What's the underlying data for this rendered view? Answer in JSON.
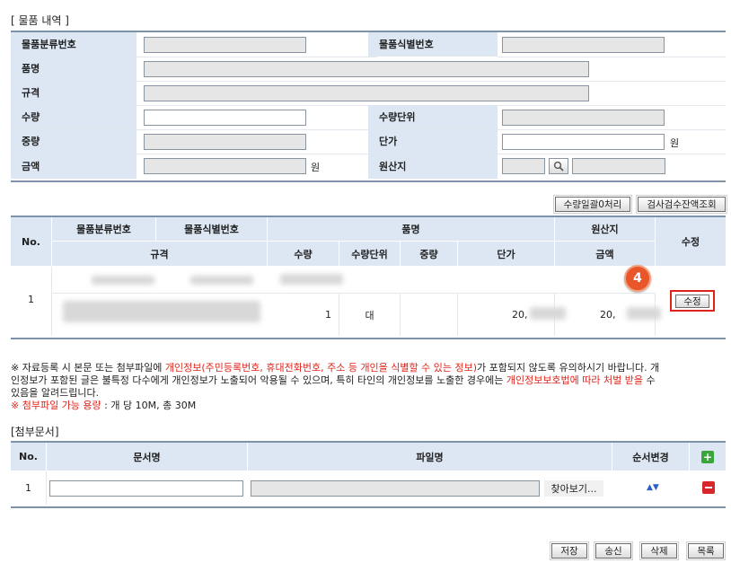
{
  "item_section": {
    "title": "[ 물품 내역 ]",
    "labels": {
      "classification_no": "물품분류번호",
      "identification_no": "물품식별번호",
      "item_name": "품명",
      "spec": "규격",
      "quantity": "수량",
      "quantity_unit": "수량단위",
      "weight": "중량",
      "unit_price": "단가",
      "amount": "금액",
      "origin": "원산지"
    },
    "unit_won": "원",
    "values": {
      "classification_no": "",
      "identification_no": "",
      "item_name": "",
      "spec": "",
      "quantity": "",
      "quantity_unit": "",
      "weight": "",
      "unit_price": "",
      "amount": "",
      "origin_code": "",
      "origin_name": ""
    }
  },
  "actions": {
    "bulk_zero_label": "수량일괄0처리",
    "inspection_balance_label": "검사검수잔액조회"
  },
  "list_table": {
    "headers": {
      "no": "No.",
      "classification_no": "물품분류번호",
      "identification_no": "물품식별번호",
      "item_name": "품명",
      "origin": "원산지",
      "edit": "수정",
      "spec": "규격",
      "quantity": "수량",
      "quantity_unit": "수량단위",
      "weight": "중량",
      "unit_price": "단가",
      "amount": "금액"
    },
    "rows": [
      {
        "no": "1",
        "quantity": "1",
        "quantity_unit": "대",
        "unit_price": "20,",
        "amount": "20,",
        "edit_label": "수정"
      }
    ]
  },
  "step_badge": "4",
  "notice": {
    "line1_prefix": "※ 자료등록 시 본문 또는 첨부파일에 ",
    "line1_red": "개인정보(주민등록번호, 휴대전화번호, 주소 등 개인을 식별할 수 있는 정보)",
    "line1_suffix": "가 포함되지 않도록 유의하시기 바랍니다. 개",
    "line2_prefix": "인정보가 포함된 글은 불특정 다수에게 개인정보가 노출되어 악용될 수 있으며, 특히 타인의 개인정보를 노출한 경우에는 ",
    "line2_red": "개인정보보호법에 따라 처벌 받을",
    "line2_suffix": " 수",
    "line3": "있음을 알려드립니다.",
    "capacity_red": "※ 첨부파일 가능 용량",
    "capacity_text": " : 개 당 10M, 총 30M"
  },
  "attachments": {
    "title": "[첨부문서]",
    "headers": {
      "no": "No.",
      "doc_name": "문서명",
      "file_name": "파일명",
      "order": "순서변경"
    },
    "rows": [
      {
        "no": "1",
        "doc_name": "",
        "file_name": "",
        "browse_label": "찾아보기..."
      }
    ]
  },
  "footer": {
    "save_label": "저장",
    "submit_label": "송신",
    "delete_label": "삭제",
    "list_label": "목록"
  },
  "colors": {
    "header_bg": "#dce7f3",
    "border": "#7f93a8",
    "red": "#e0241b",
    "badge": "#e8562a"
  }
}
